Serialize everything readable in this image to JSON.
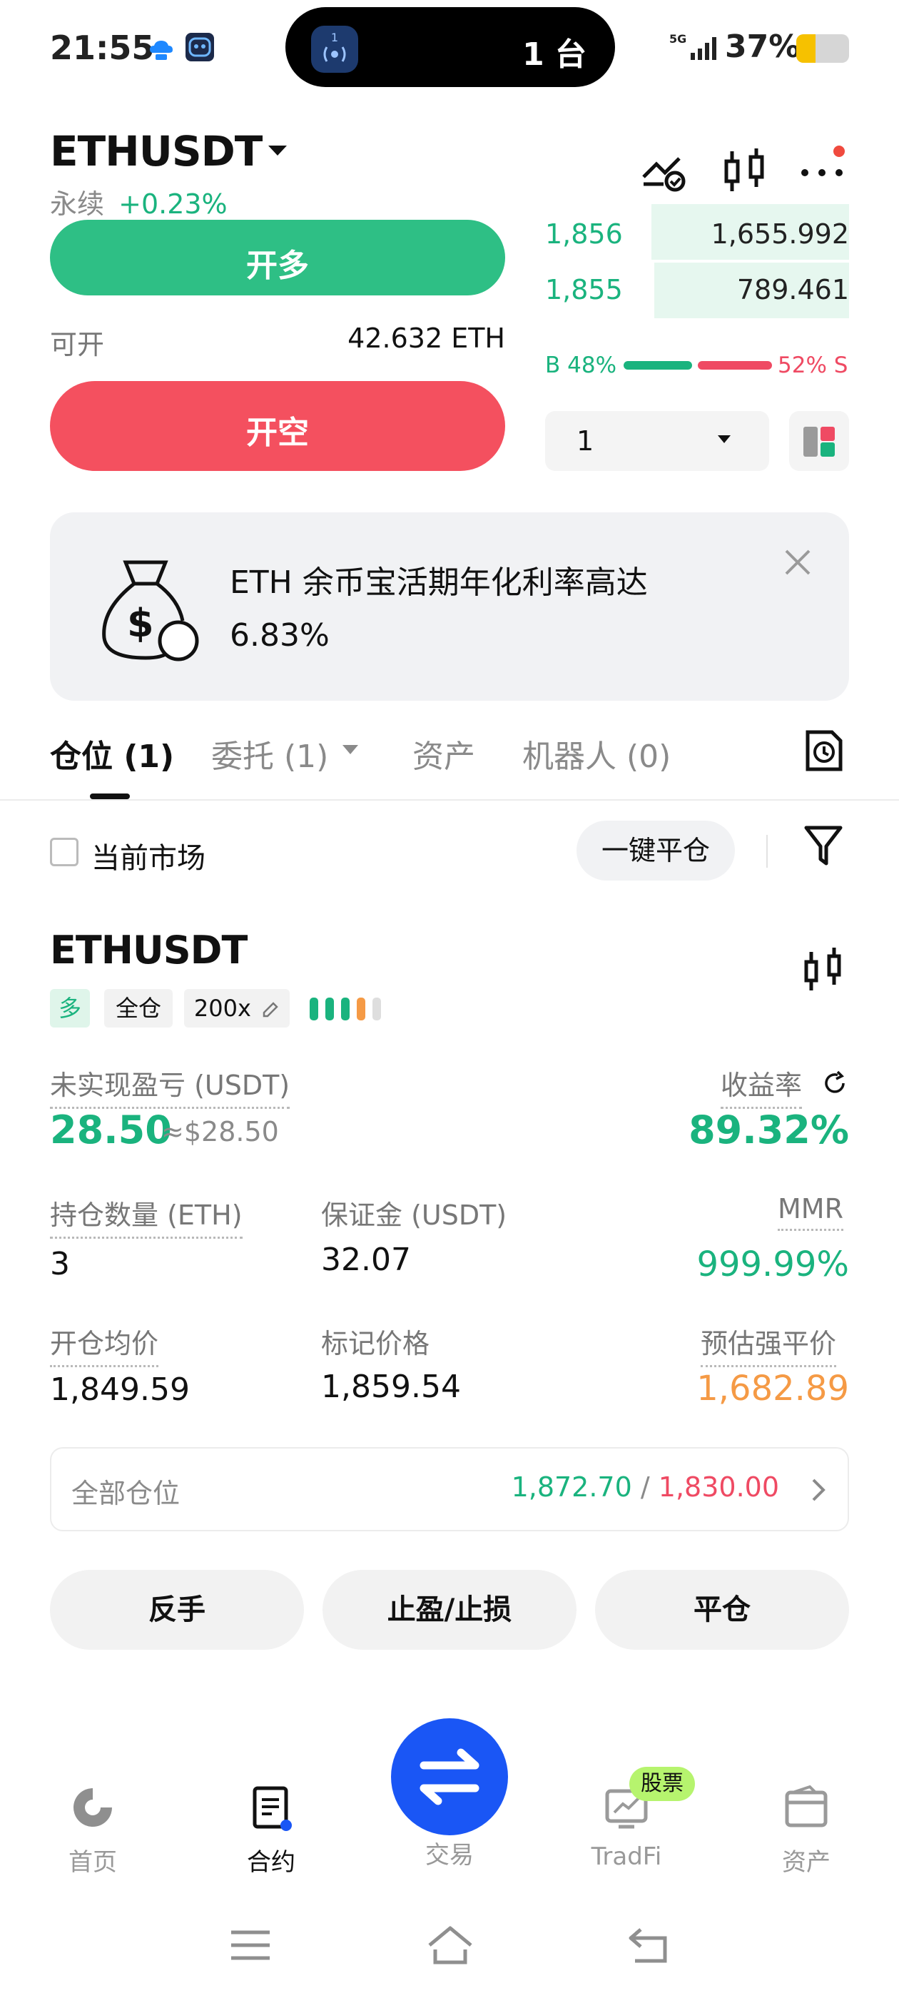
{
  "status_bar": {
    "time": "21:55",
    "island_text": "1 台",
    "island_badge": "1",
    "signal": "5G",
    "battery_text": "37%",
    "battery_level": 0.37
  },
  "header": {
    "symbol": "ETHUSDT",
    "type": "永续",
    "change": "+0.23%"
  },
  "order_panel": {
    "long_label": "开多",
    "short_label": "开空",
    "available_label": "可开",
    "available_value": "42.632 ETH"
  },
  "orderbook": {
    "rows": [
      {
        "price": "1,856",
        "qty": "1,655.992",
        "depth": 0.35
      },
      {
        "price": "1,855",
        "qty": "789.461",
        "depth": 0.36
      }
    ],
    "buy_ratio": "B 48%",
    "sell_ratio": "52% S",
    "depth_value": "1"
  },
  "banner": {
    "line1": "ETH 余币宝活期年化利率高达",
    "line2": "6.83%"
  },
  "tabs": [
    {
      "label": "仓位 (1)"
    },
    {
      "label": "委托 (1)"
    },
    {
      "label": "资产"
    },
    {
      "label": "机器人 (0)"
    }
  ],
  "filter": {
    "current_market": "当前市场",
    "close_all": "一键平仓"
  },
  "position": {
    "symbol": "ETHUSDT",
    "side": "多",
    "margin_mode": "全仓",
    "leverage": "200x",
    "unrealized_pnl_label": "未实现盈亏 (USDT)",
    "unrealized_pnl": "28.50",
    "unrealized_pnl_usd": "≈$28.50",
    "roe_label": "收益率",
    "roe": "89.32%",
    "size_label": "持仓数量 (ETH)",
    "size": "3",
    "margin_label": "保证金 (USDT)",
    "margin": "32.07",
    "mmr_label": "MMR",
    "mmr": "999.99%",
    "entry_label": "开仓均价",
    "entry": "1,849.59",
    "mark_label": "标记价格",
    "mark": "1,859.54",
    "liq_label": "预估强平价",
    "liq": "1,682.89",
    "all_positions_label": "全部仓位",
    "tp_value": "1,872.70",
    "separator": "/",
    "sl_value": "1,830.00"
  },
  "actions": {
    "reverse": "反手",
    "tpsl": "止盈/止损",
    "close": "平仓"
  },
  "nav": {
    "home": "首页",
    "contract": "合约",
    "trade": "交易",
    "tradfi": "TradFi",
    "tradfi_badge": "股票",
    "assets": "资产"
  },
  "colors": {
    "green": "#1ab37e",
    "red": "#ef4a63",
    "orange": "#f59a45",
    "brand_blue": "#1a56f5"
  }
}
